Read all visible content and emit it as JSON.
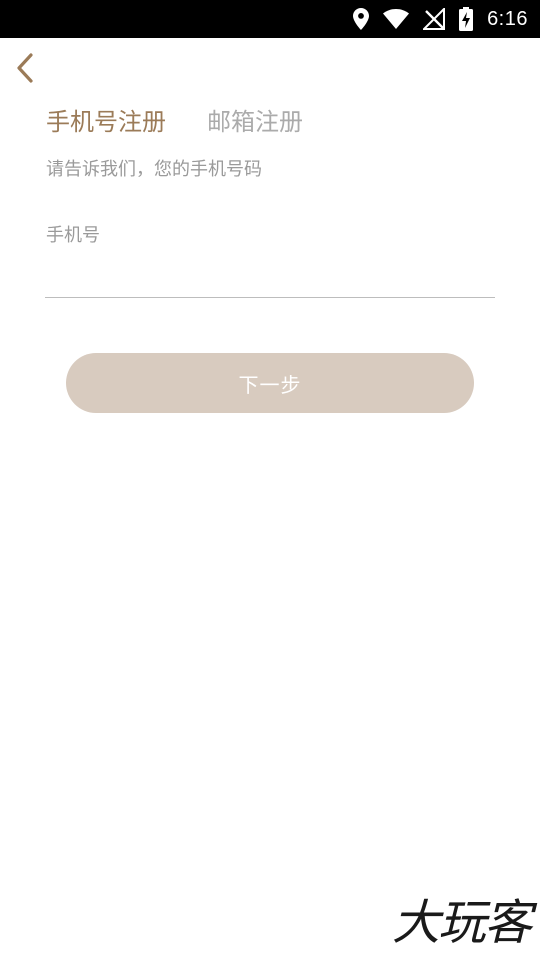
{
  "status_bar": {
    "time": "6:16",
    "icons": [
      "location-icon",
      "wifi-icon",
      "no-signal-icon",
      "battery-charging-icon"
    ]
  },
  "header": {
    "back_icon": "chevron-left-icon"
  },
  "tabs": [
    {
      "label": "手机号注册",
      "active": true
    },
    {
      "label": "邮箱注册",
      "active": false
    }
  ],
  "subtitle": "请告诉我们，您的手机号码",
  "form": {
    "phone_label": "手机号",
    "phone_value": "",
    "next_label": "下一步"
  },
  "watermark": "大玩客",
  "colors": {
    "accent": "#9b7b58",
    "button_disabled": "#d8cbbf",
    "inactive_text": "#ababab"
  }
}
